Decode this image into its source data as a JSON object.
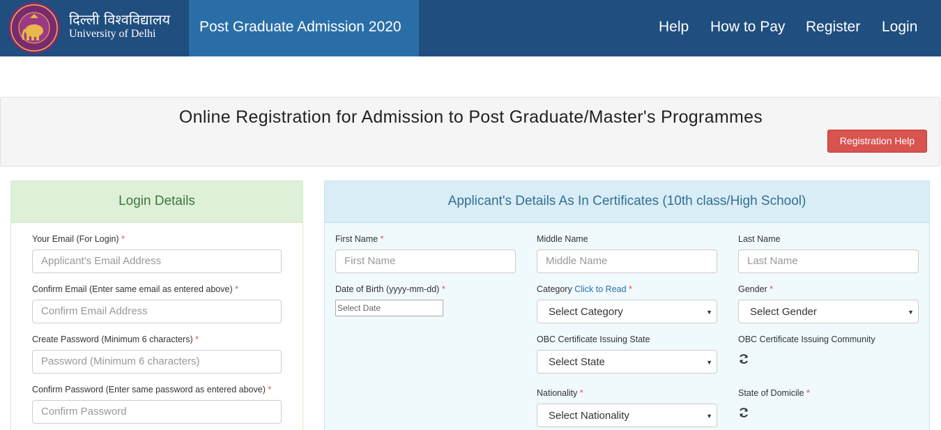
{
  "header": {
    "brand_hindi": "दिल्ली विश्वविद्यालय",
    "brand_english": "University of Delhi",
    "admission_title": "Post Graduate Admission 2020",
    "nav": [
      "Help",
      "How to Pay",
      "Register",
      "Login"
    ],
    "logo_icon": "university-seal-icon"
  },
  "banner": {
    "title": "Online Registration for Admission to Post Graduate/Master's Programmes",
    "help_button": "Registration Help"
  },
  "login_panel": {
    "title": "Login Details",
    "fields": [
      {
        "label": "Your Email (For Login)",
        "required": "*",
        "placeholder": "Applicant's Email Address"
      },
      {
        "label": "Confirm Email (Enter same email as entered above)",
        "required": "*",
        "placeholder": "Confirm Email Address"
      },
      {
        "label": "Create Password (Minimum 6 characters)",
        "required": "*",
        "placeholder": "Password (Minimum 6 characters)"
      },
      {
        "label": "Confirm Password (Enter same password as entered above)",
        "required": "*",
        "placeholder": "Confirm Password"
      }
    ]
  },
  "applicant_panel": {
    "title": "Applicant's Details As In Certificates (10th class/High School)",
    "first_name": {
      "label": "First Name",
      "required": "*",
      "placeholder": "First Name"
    },
    "middle_name": {
      "label": "Middle Name",
      "placeholder": "Middle Name"
    },
    "last_name": {
      "label": "Last Name",
      "placeholder": "Last Name"
    },
    "dob": {
      "label": "Date of Birth (yyyy-mm-dd)",
      "required": "*",
      "placeholder": "Select Date"
    },
    "category": {
      "label": "Category",
      "link": "Click to Read",
      "required": "*",
      "value": "Select Category"
    },
    "gender": {
      "label": "Gender",
      "required": "*",
      "value": "Select Gender"
    },
    "obc_state": {
      "label": "OBC Certificate Issuing State",
      "value": "Select State"
    },
    "obc_community": {
      "label": "OBC Certificate Issuing Community"
    },
    "nationality": {
      "label": "Nationality",
      "required": "*",
      "value": "Select Nationality"
    },
    "domicile": {
      "label": "State of Domicile",
      "required": "*"
    }
  },
  "colors": {
    "header_bg": "#1f4e7f",
    "title_tab_bg": "#2a6ea8",
    "danger": "#d9534f",
    "success_bg": "#dff0d8",
    "info_bg": "#d9edf7"
  }
}
